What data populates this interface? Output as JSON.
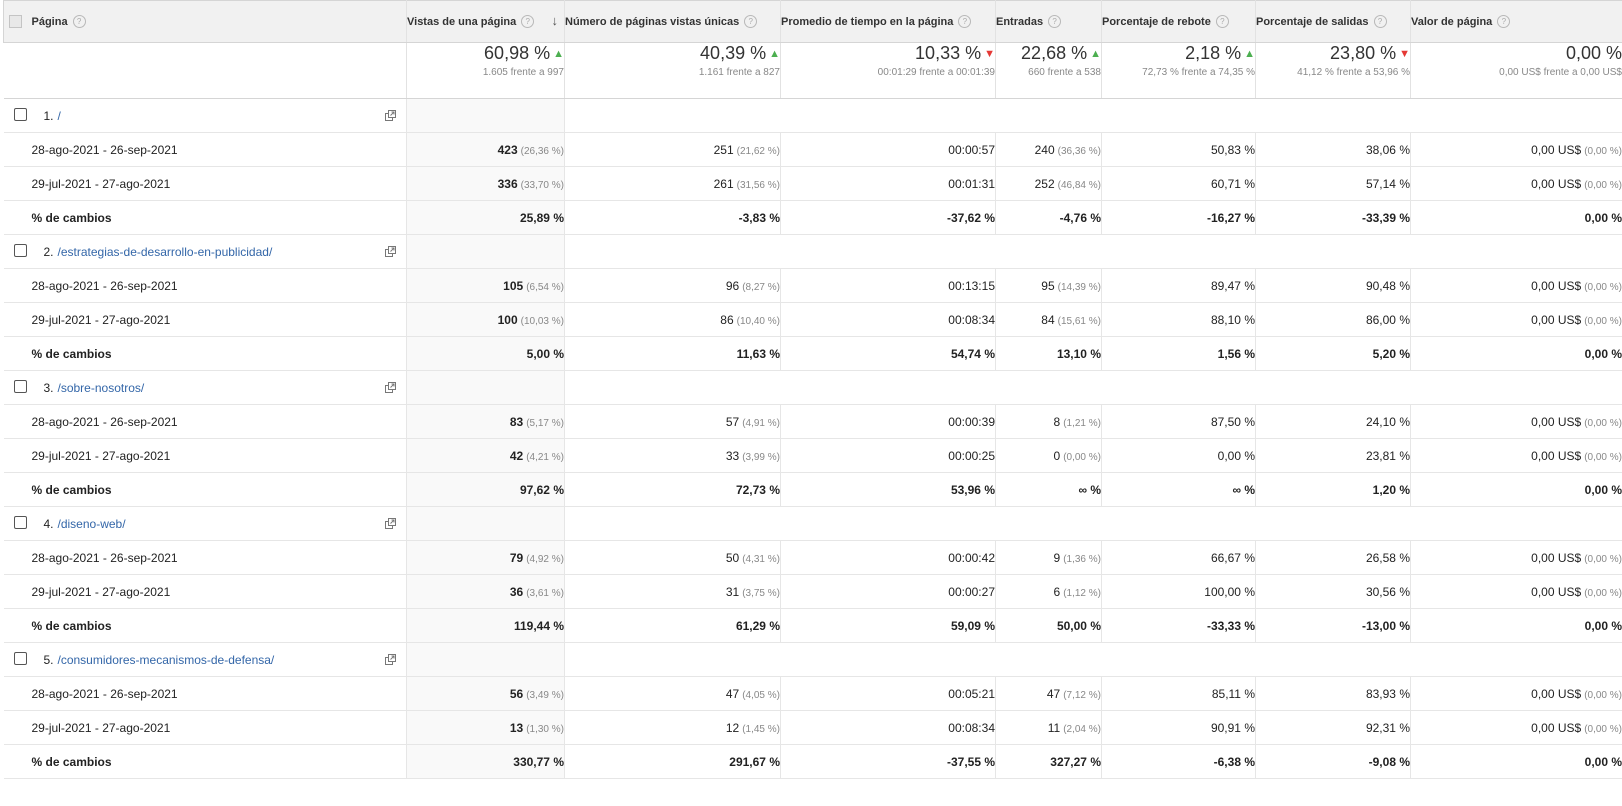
{
  "header": {
    "page_label": "Página",
    "columns": [
      "Vistas de una página",
      "Número de páginas vistas únicas",
      "Promedio de tiempo en la página",
      "Entradas",
      "Porcentaje de rebote",
      "Porcentaje de salidas",
      "Valor de página"
    ]
  },
  "summary": [
    {
      "value": "60,98 %",
      "dir": "up",
      "sub": "1.605 frente a 997"
    },
    {
      "value": "40,39 %",
      "dir": "up",
      "sub": "1.161 frente a 827"
    },
    {
      "value": "10,33 %",
      "dir": "down",
      "sub": "00:01:29 frente a 00:01:39"
    },
    {
      "value": "22,68 %",
      "dir": "up",
      "sub": "660 frente a 538"
    },
    {
      "value": "2,18 %",
      "dir": "up",
      "sub": "72,73 % frente a 74,35 %"
    },
    {
      "value": "23,80 %",
      "dir": "down",
      "sub": "41,12 % frente a 53,96 %"
    },
    {
      "value": "0,00 %",
      "dir": "",
      "sub": "0,00 US$ frente a 0,00 US$"
    }
  ],
  "rows": [
    {
      "index": "1.",
      "page": "/",
      "current": {
        "label": "28-ago-2021 - 26-sep-2021",
        "cells": [
          [
            "423",
            "(26,36 %)"
          ],
          [
            "251",
            "(21,62 %)"
          ],
          [
            "00:00:57",
            ""
          ],
          [
            "240",
            "(36,36 %)"
          ],
          [
            "50,83 %",
            ""
          ],
          [
            "38,06 %",
            ""
          ],
          [
            "0,00 US$",
            "(0,00 %)"
          ]
        ]
      },
      "previous": {
        "label": "29-jul-2021 - 27-ago-2021",
        "cells": [
          [
            "336",
            "(33,70 %)"
          ],
          [
            "261",
            "(31,56 %)"
          ],
          [
            "00:01:31",
            ""
          ],
          [
            "252",
            "(46,84 %)"
          ],
          [
            "60,71 %",
            ""
          ],
          [
            "57,14 %",
            ""
          ],
          [
            "0,00 US$",
            "(0,00 %)"
          ]
        ]
      },
      "change": {
        "label": "% de cambios",
        "cells": [
          "25,89 %",
          "-3,83 %",
          "-37,62 %",
          "-4,76 %",
          "-16,27 %",
          "-33,39 %",
          "0,00 %"
        ]
      }
    },
    {
      "index": "2.",
      "page": "/estrategias-de-desarrollo-en-publicidad/",
      "current": {
        "label": "28-ago-2021 - 26-sep-2021",
        "cells": [
          [
            "105",
            "(6,54 %)"
          ],
          [
            "96",
            "(8,27 %)"
          ],
          [
            "00:13:15",
            ""
          ],
          [
            "95",
            "(14,39 %)"
          ],
          [
            "89,47 %",
            ""
          ],
          [
            "90,48 %",
            ""
          ],
          [
            "0,00 US$",
            "(0,00 %)"
          ]
        ]
      },
      "previous": {
        "label": "29-jul-2021 - 27-ago-2021",
        "cells": [
          [
            "100",
            "(10,03 %)"
          ],
          [
            "86",
            "(10,40 %)"
          ],
          [
            "00:08:34",
            ""
          ],
          [
            "84",
            "(15,61 %)"
          ],
          [
            "88,10 %",
            ""
          ],
          [
            "86,00 %",
            ""
          ],
          [
            "0,00 US$",
            "(0,00 %)"
          ]
        ]
      },
      "change": {
        "label": "% de cambios",
        "cells": [
          "5,00 %",
          "11,63 %",
          "54,74 %",
          "13,10 %",
          "1,56 %",
          "5,20 %",
          "0,00 %"
        ]
      }
    },
    {
      "index": "3.",
      "page": "/sobre-nosotros/",
      "current": {
        "label": "28-ago-2021 - 26-sep-2021",
        "cells": [
          [
            "83",
            "(5,17 %)"
          ],
          [
            "57",
            "(4,91 %)"
          ],
          [
            "00:00:39",
            ""
          ],
          [
            "8",
            "(1,21 %)"
          ],
          [
            "87,50 %",
            ""
          ],
          [
            "24,10 %",
            ""
          ],
          [
            "0,00 US$",
            "(0,00 %)"
          ]
        ]
      },
      "previous": {
        "label": "29-jul-2021 - 27-ago-2021",
        "cells": [
          [
            "42",
            "(4,21 %)"
          ],
          [
            "33",
            "(3,99 %)"
          ],
          [
            "00:00:25",
            ""
          ],
          [
            "0",
            "(0,00 %)"
          ],
          [
            "0,00 %",
            ""
          ],
          [
            "23,81 %",
            ""
          ],
          [
            "0,00 US$",
            "(0,00 %)"
          ]
        ]
      },
      "change": {
        "label": "% de cambios",
        "cells": [
          "97,62 %",
          "72,73 %",
          "53,96 %",
          "∞ %",
          "∞ %",
          "1,20 %",
          "0,00 %"
        ]
      }
    },
    {
      "index": "4.",
      "page": "/diseno-web/",
      "current": {
        "label": "28-ago-2021 - 26-sep-2021",
        "cells": [
          [
            "79",
            "(4,92 %)"
          ],
          [
            "50",
            "(4,31 %)"
          ],
          [
            "00:00:42",
            ""
          ],
          [
            "9",
            "(1,36 %)"
          ],
          [
            "66,67 %",
            ""
          ],
          [
            "26,58 %",
            ""
          ],
          [
            "0,00 US$",
            "(0,00 %)"
          ]
        ]
      },
      "previous": {
        "label": "29-jul-2021 - 27-ago-2021",
        "cells": [
          [
            "36",
            "(3,61 %)"
          ],
          [
            "31",
            "(3,75 %)"
          ],
          [
            "00:00:27",
            ""
          ],
          [
            "6",
            "(1,12 %)"
          ],
          [
            "100,00 %",
            ""
          ],
          [
            "30,56 %",
            ""
          ],
          [
            "0,00 US$",
            "(0,00 %)"
          ]
        ]
      },
      "change": {
        "label": "% de cambios",
        "cells": [
          "119,44 %",
          "61,29 %",
          "59,09 %",
          "50,00 %",
          "-33,33 %",
          "-13,00 %",
          "0,00 %"
        ]
      }
    },
    {
      "index": "5.",
      "page": "/consumidores-mecanismos-de-defensa/",
      "current": {
        "label": "28-ago-2021 - 26-sep-2021",
        "cells": [
          [
            "56",
            "(3,49 %)"
          ],
          [
            "47",
            "(4,05 %)"
          ],
          [
            "00:05:21",
            ""
          ],
          [
            "47",
            "(7,12 %)"
          ],
          [
            "85,11 %",
            ""
          ],
          [
            "83,93 %",
            ""
          ],
          [
            "0,00 US$",
            "(0,00 %)"
          ]
        ]
      },
      "previous": {
        "label": "29-jul-2021 - 27-ago-2021",
        "cells": [
          [
            "13",
            "(1,30 %)"
          ],
          [
            "12",
            "(1,45 %)"
          ],
          [
            "00:08:34",
            ""
          ],
          [
            "11",
            "(2,04 %)"
          ],
          [
            "90,91 %",
            ""
          ],
          [
            "92,31 %",
            ""
          ],
          [
            "0,00 US$",
            "(0,00 %)"
          ]
        ]
      },
      "change": {
        "label": "% de cambios",
        "cells": [
          "330,77 %",
          "291,67 %",
          "-37,55 %",
          "327,27 %",
          "-6,38 %",
          "-9,08 %",
          "0,00 %"
        ]
      }
    }
  ],
  "icons": {
    "sort": "sort-down-arrow-icon",
    "help": "help-icon",
    "open": "open-in-new-window-icon",
    "up": "trend-up-icon",
    "down": "trend-down-icon"
  },
  "colors": {
    "link": "#3366a8",
    "up": "#4caf50",
    "down": "#e53935",
    "header_bg": "#f1f1f1"
  }
}
